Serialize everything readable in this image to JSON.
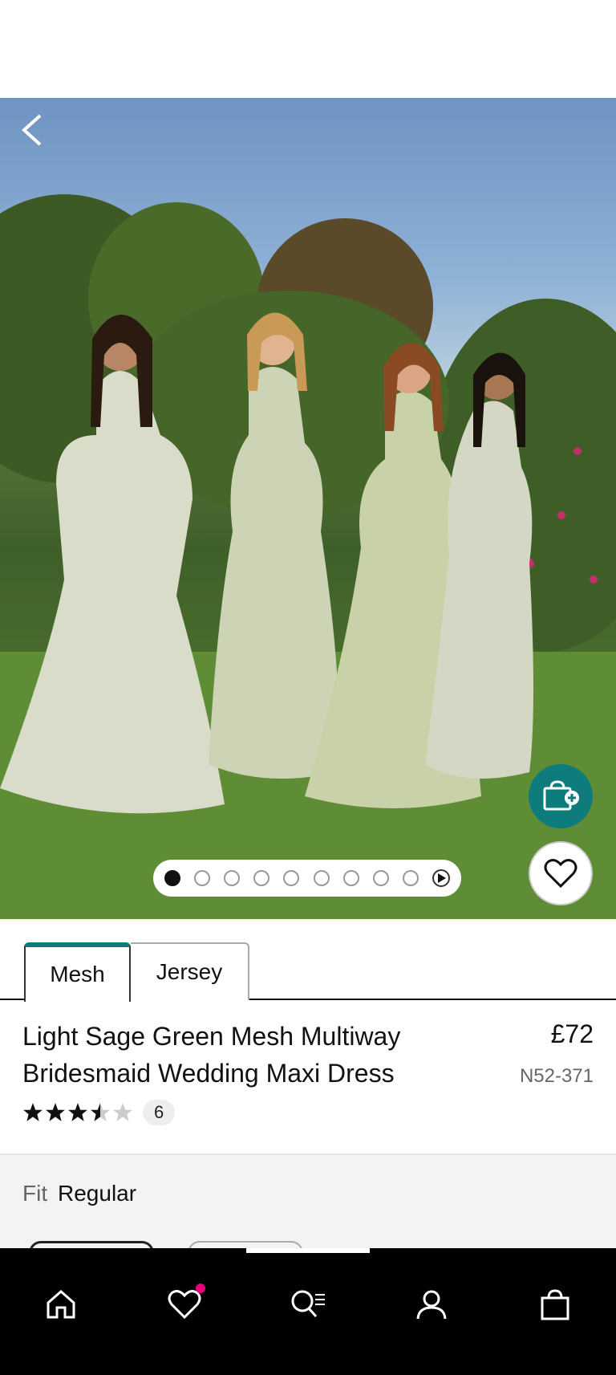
{
  "hero": {
    "active_slide": 1,
    "slide_count": 9,
    "has_video": true
  },
  "tabs": [
    {
      "label": "Mesh",
      "active": true
    },
    {
      "label": "Jersey",
      "active": false
    }
  ],
  "product": {
    "title": "Light Sage Green Mesh Multiway Bridesmaid Wedding Maxi Dress",
    "price": "£72",
    "sku": "N52-371",
    "rating": 3.5,
    "rating_max": 5,
    "review_count": "6"
  },
  "fit": {
    "label": "Fit",
    "value": "Regular"
  },
  "colors": {
    "accent": "#0e7c7c",
    "badge": "#e6007e",
    "nav_bg": "#000000"
  },
  "icons": {
    "back": "chevron-left-icon",
    "add_to_bag": "bag-plus-icon",
    "favourite": "heart-icon",
    "nav": [
      "home-icon",
      "heart-icon",
      "search-list-icon",
      "user-icon",
      "bag-icon"
    ]
  }
}
